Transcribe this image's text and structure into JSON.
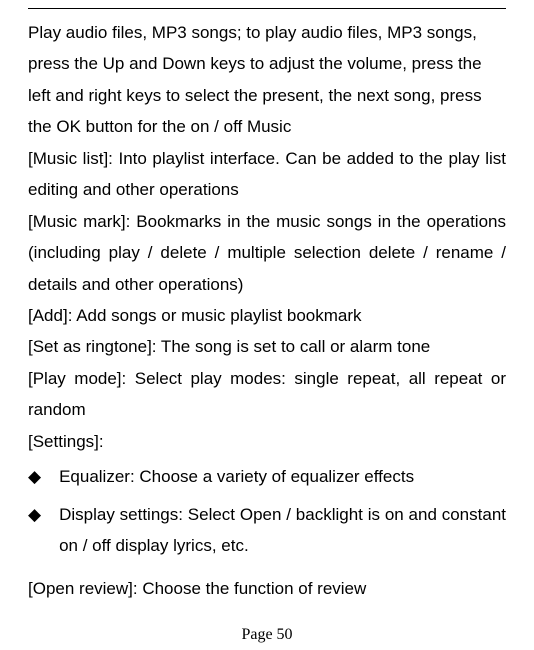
{
  "intro": "Play audio files, MP3 songs; to play audio files, MP3 songs, press the Up and Down keys to adjust the volume, press the left and right keys to select the present, the next song, press the OK button for the on / off Music",
  "music_list": "[Music list]: Into playlist interface. Can be added to the play list editing and other operations",
  "music_mark": "[Music mark]: Bookmarks in the music songs in the operations (including play / delete / multiple selection delete / rename / details and other operations)",
  "add": "[Add]: Add songs or music playlist bookmark",
  "set_ringtone": "[Set as ringtone]: The song is set to call or alarm tone",
  "play_mode": "[Play mode]: Select play modes: single repeat, all repeat or random",
  "settings": "[Settings]:",
  "bullets": {
    "equalizer": "Equalizer: Choose a variety of equalizer effects",
    "display": "Display settings: Select Open / backlight is on and constant on / off display lyrics, etc."
  },
  "open_review": "[Open review]: Choose the function of review",
  "page_number": "Page 50",
  "diamond": "◆"
}
